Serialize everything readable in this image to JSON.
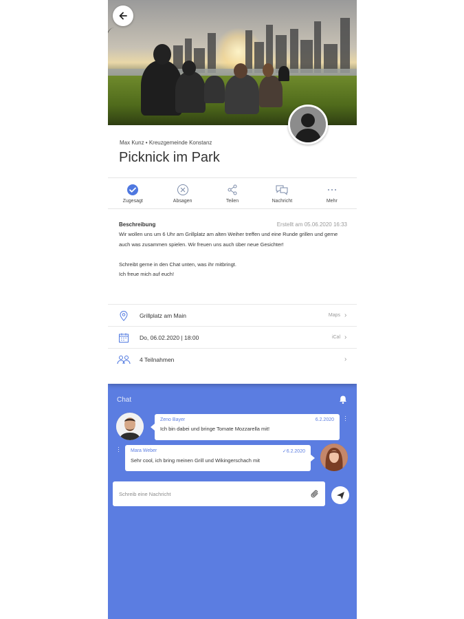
{
  "event": {
    "meta": "Max Kunz • Kreuzgemeinde Konstanz",
    "title": "Picknick im Park"
  },
  "actions": [
    {
      "label": "Zugesagt",
      "icon": "check-circle-icon"
    },
    {
      "label": "Absagen",
      "icon": "x-circle-icon"
    },
    {
      "label": "Teilen",
      "icon": "share-icon"
    },
    {
      "label": "Nachricht",
      "icon": "chat-icon"
    },
    {
      "label": "Mehr",
      "icon": "more-icon"
    }
  ],
  "description": {
    "heading": "Beschreibung",
    "created": "Erstellt am 05.06.2020 16:33",
    "body": "Wir wollen uns um 6 Uhr am Grillplatz am alten Weiher treffen und eine Runde grillen und gerne auch was zusammen spielen. Wir freuen uns auch über neue Gesichter!\n\nSchreibt gerne in den Chat unten, was ihr mitbringt.\nIch freue mich auf euch!"
  },
  "details": [
    {
      "text": "Grillplatz am Main",
      "action": "Maps",
      "icon": "location-icon"
    },
    {
      "text": "Do, 06.02.2020 | 18:00",
      "action": "iCal",
      "icon": "calendar-icon"
    },
    {
      "text": "4 Teilnahmen",
      "action": "",
      "icon": "people-icon"
    }
  ],
  "chat": {
    "title": "Chat",
    "messages": [
      {
        "author": "Zeno Bayer",
        "date": "6.2.2020",
        "text": "Ich bin dabei und bringe Tomate Mozzarella mit!"
      },
      {
        "author": "Mara Weber",
        "date": "✓6.2.2020",
        "text": "Sehr cool, ich bring meinen Grill und Wikingerschach mit"
      }
    ],
    "input_placeholder": "Schreib eine Nachricht"
  },
  "colors": {
    "accent": "#5b7de1",
    "icon_blue": "#4f78e0"
  }
}
